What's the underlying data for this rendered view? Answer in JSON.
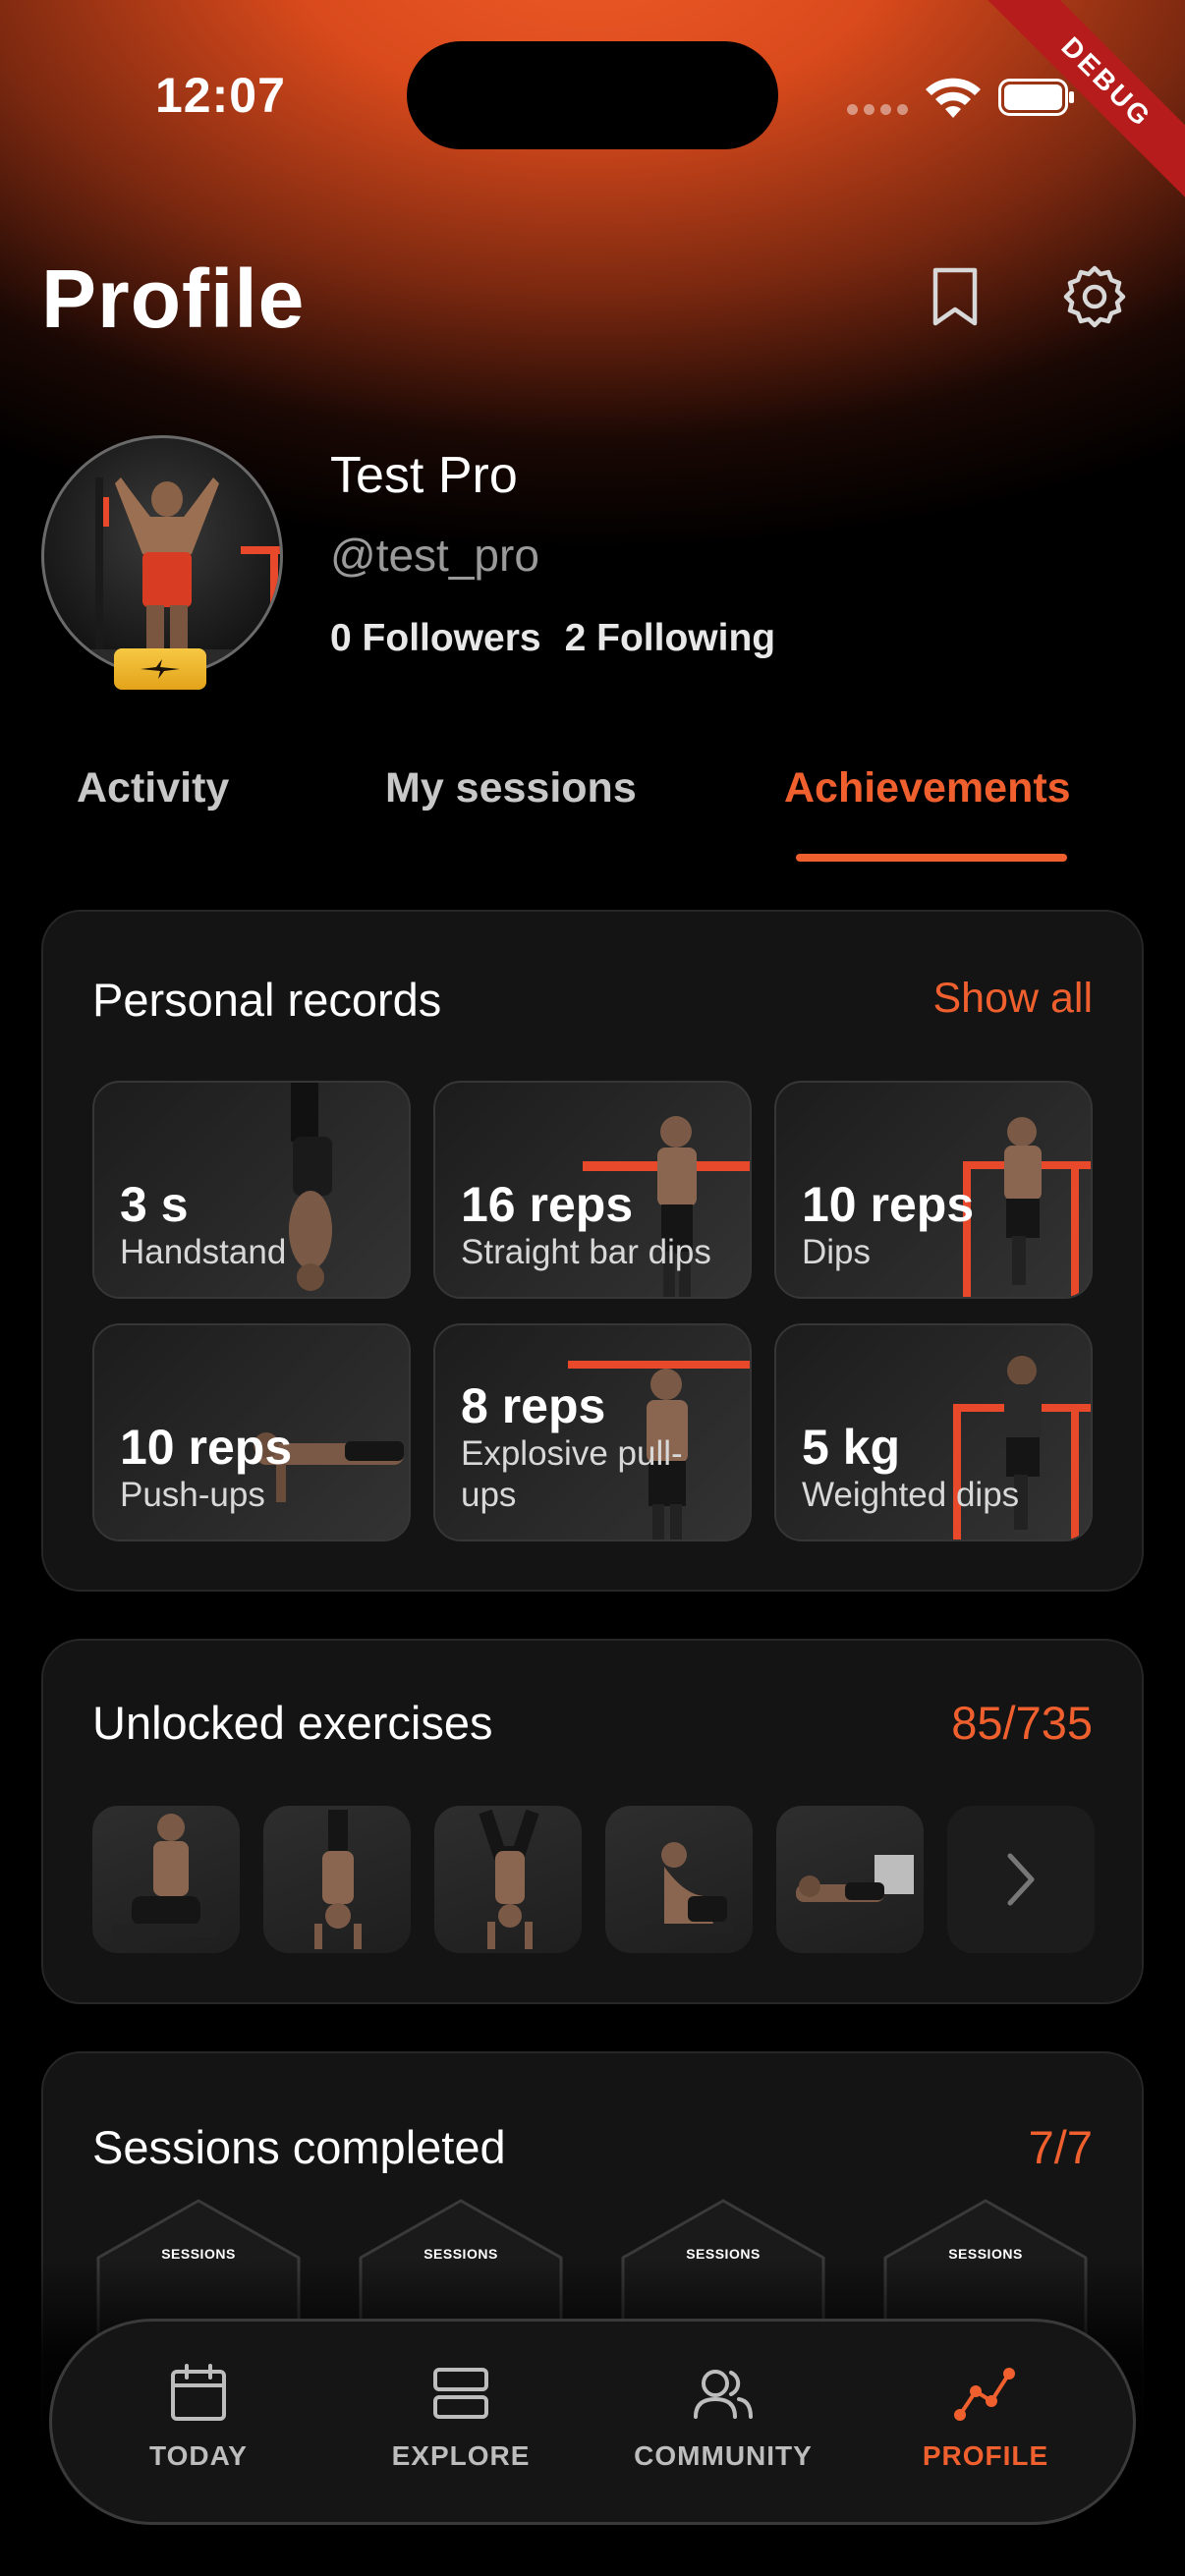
{
  "status_bar": {
    "time": "12:07",
    "debug_label": "DEBUG"
  },
  "header": {
    "title": "Profile",
    "bookmark_icon": "bookmark-icon",
    "settings_icon": "gear-icon"
  },
  "profile": {
    "name": "Test Pro",
    "handle": "@test_pro",
    "followers_count": "0",
    "followers_label": "Followers",
    "following_count": "2",
    "following_label": "Following"
  },
  "tabs": [
    {
      "label": "Activity",
      "active": false
    },
    {
      "label": "My sessions",
      "active": false
    },
    {
      "label": "Achievements",
      "active": true
    }
  ],
  "personal_records": {
    "title": "Personal records",
    "action": "Show all",
    "items": [
      {
        "value": "3 s",
        "label": "Handstand"
      },
      {
        "value": "16 reps",
        "label": "Straight bar dips"
      },
      {
        "value": "10 reps",
        "label": "Dips"
      },
      {
        "value": "10 reps",
        "label": "Push-ups"
      },
      {
        "value": "8 reps",
        "label": "Explosive pull-ups"
      },
      {
        "value": "5 kg",
        "label": "Weighted dips"
      }
    ]
  },
  "unlocked_exercises": {
    "title": "Unlocked exercises",
    "count": "85/735"
  },
  "sessions_completed": {
    "title": "Sessions completed",
    "count": "7/7",
    "badge_label": "SESSIONS"
  },
  "bottom_nav": [
    {
      "label": "TODAY",
      "icon": "calendar-icon",
      "active": false
    },
    {
      "label": "EXPLORE",
      "icon": "layers-icon",
      "active": false
    },
    {
      "label": "COMMUNITY",
      "icon": "users-icon",
      "active": false
    },
    {
      "label": "PROFILE",
      "icon": "chart-line-icon",
      "active": true
    }
  ],
  "colors": {
    "accent": "#f0602e",
    "background": "#000000",
    "card": "#141414",
    "badge_gold": "#f7c843"
  }
}
